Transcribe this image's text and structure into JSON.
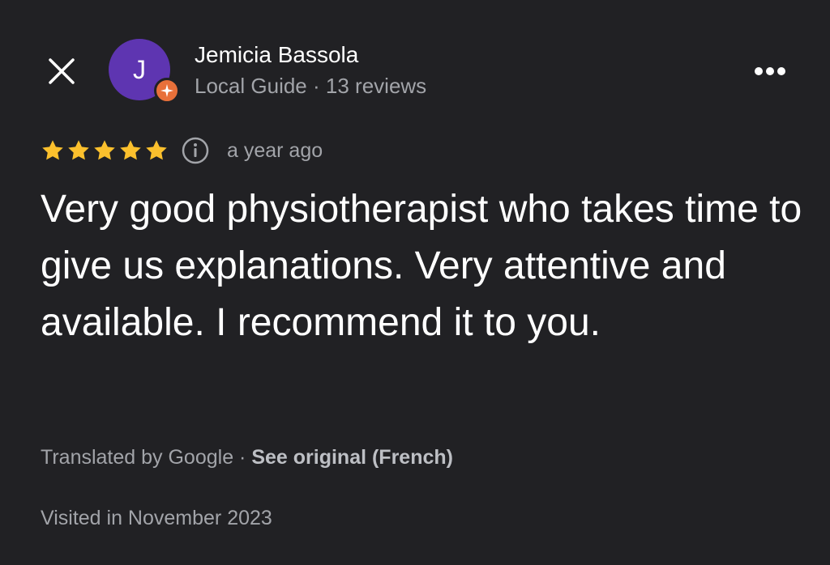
{
  "header": {
    "close_icon": "close-icon",
    "more_icon": "more-horizontal-icon"
  },
  "author": {
    "avatar_letter": "J",
    "avatar_color": "#5e35b1",
    "badge_color": "#e8703a",
    "badge_icon": "local-guide-star-icon",
    "name": "Jemicia Bassola",
    "role": "Local Guide",
    "separator": "·",
    "reviews": "13 reviews"
  },
  "rating": {
    "stars": 5,
    "max": 5,
    "star_color": "#fbc02d",
    "info_icon": "info-icon",
    "date": "a year ago"
  },
  "review": {
    "text": "Very good physiotherapist who takes time to give us explanations. Very attentive and available. I recommend it to you."
  },
  "translation": {
    "label": "Translated by Google",
    "separator": " · ",
    "link": "See original (French)"
  },
  "visit": {
    "text": "Visited in November 2023"
  },
  "colors": {
    "background": "#212124",
    "primary_text": "#ffffff",
    "secondary_text": "#a2a4a9"
  }
}
